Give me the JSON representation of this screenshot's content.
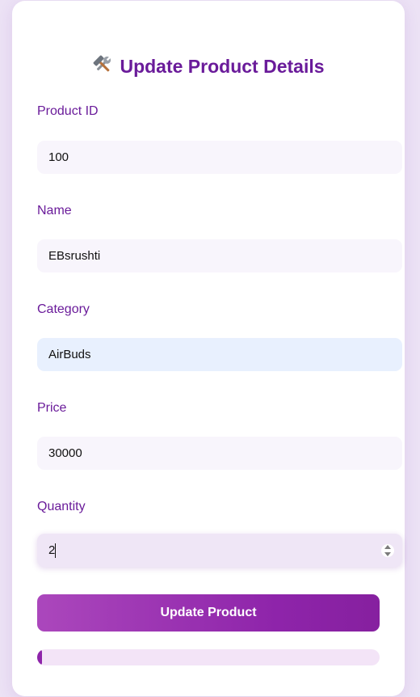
{
  "form": {
    "title": "Update Product Details",
    "title_icon": "tools-icon",
    "fields": {
      "product_id": {
        "label": "Product ID",
        "value": "100"
      },
      "name": {
        "label": "Name",
        "value": "EBsrushti"
      },
      "category": {
        "label": "Category",
        "value": "AirBuds"
      },
      "price": {
        "label": "Price",
        "value": "30000"
      },
      "quantity": {
        "label": "Quantity",
        "value": "2"
      }
    },
    "submit_label": "Update Product",
    "progress_percent": 1.5
  },
  "colors": {
    "accent": "#6a1b9a",
    "button_start": "#ab47bc",
    "button_end": "#8e24aa",
    "background": "#ece2f5"
  }
}
